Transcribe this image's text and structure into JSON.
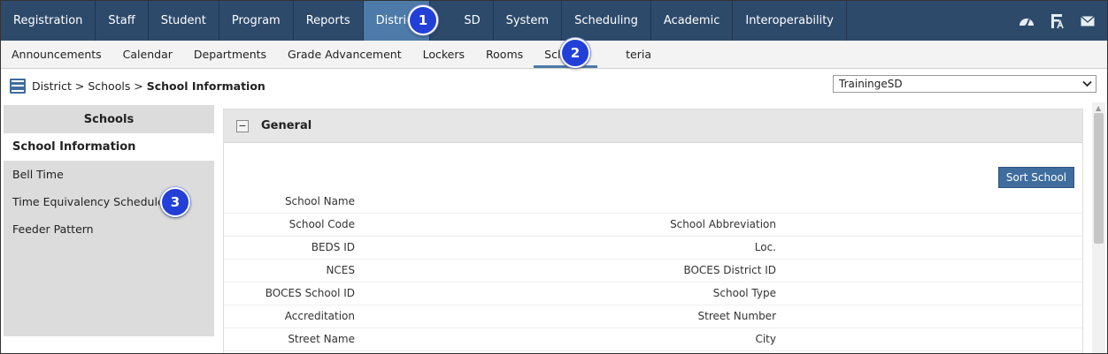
{
  "top_nav": {
    "tabs": [
      "Registration",
      "Staff",
      "Student",
      "Program",
      "Reports",
      "District",
      "SD",
      "System",
      "Scheduling",
      "Academic",
      "Interoperability"
    ],
    "active": "District",
    "icons": [
      "dashboard-icon",
      "reports-icon",
      "mail-icon"
    ]
  },
  "sub_nav": {
    "tabs": [
      "Announcements",
      "Calendar",
      "Departments",
      "Grade Advancement",
      "Lockers",
      "Rooms",
      "Schools",
      "teria"
    ],
    "active": "Schools"
  },
  "breadcrumb": {
    "path": "District > Schools > ",
    "current": "School Information"
  },
  "district_select": {
    "value": "TrainingeSD"
  },
  "left_panel": {
    "title": "Schools",
    "items": [
      "School Information",
      "Bell Time",
      "Time Equivalency Schedule",
      "Feeder Pattern"
    ],
    "active": "School Information"
  },
  "general_section": {
    "title": "General",
    "collapse_symbol": "−",
    "sort_button": "Sort School",
    "rows": [
      {
        "left": "School Name",
        "right": ""
      },
      {
        "left": "School Code",
        "right": "School Abbreviation"
      },
      {
        "left": "BEDS ID",
        "right": "Loc."
      },
      {
        "left": "NCES",
        "right": "BOCES District ID"
      },
      {
        "left": "BOCES School ID",
        "right": "School Type"
      },
      {
        "left": "Accreditation",
        "right": "Street Number"
      },
      {
        "left": "Street Name",
        "right": "City"
      }
    ]
  },
  "callouts": [
    "1",
    "2",
    "3"
  ],
  "colors": {
    "nav_bg": "#2d4a6b",
    "nav_active": "#4d7aa8",
    "button": "#3f6d9d",
    "callout": "#2240d8"
  }
}
